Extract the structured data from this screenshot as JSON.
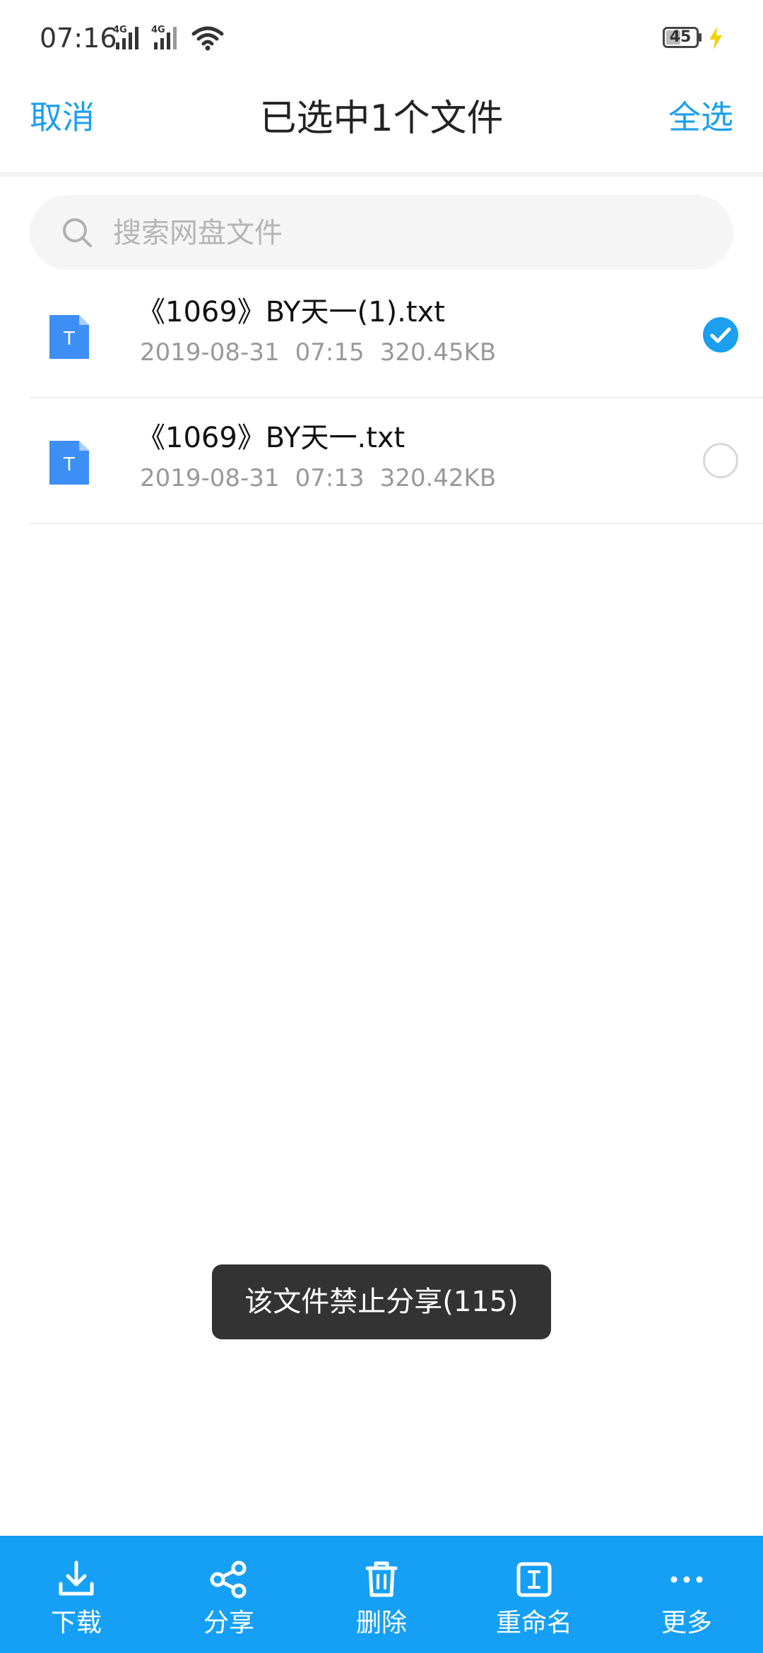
{
  "status_bar": {
    "time": "07:16",
    "network_1": "4G",
    "network_2": "4G",
    "battery": "45"
  },
  "header": {
    "cancel_label": "取消",
    "title": "已选中1个文件",
    "select_all_label": "全选"
  },
  "search": {
    "placeholder": "搜索网盘文件"
  },
  "files": [
    {
      "name": "《1069》BY天一(1).txt",
      "date": "2019-08-31",
      "time": "07:15",
      "size": "320.45KB",
      "selected": true,
      "icon_letter": "T"
    },
    {
      "name": "《1069》BY天一.txt",
      "date": "2019-08-31",
      "time": "07:13",
      "size": "320.42KB",
      "selected": false,
      "icon_letter": "T"
    }
  ],
  "toast": {
    "message": "该文件禁止分享(115)"
  },
  "bottom_bar": {
    "items": [
      {
        "label": "下载",
        "icon": "download-icon"
      },
      {
        "label": "分享",
        "icon": "share-icon"
      },
      {
        "label": "删除",
        "icon": "trash-icon"
      },
      {
        "label": "重命名",
        "icon": "rename-icon"
      },
      {
        "label": "更多",
        "icon": "more-icon"
      }
    ]
  },
  "colors": {
    "accent": "#1b9ff0",
    "bottom_bar": "#15a0f5",
    "file_icon": "#3d8ef5",
    "toast_bg": "#333333"
  }
}
